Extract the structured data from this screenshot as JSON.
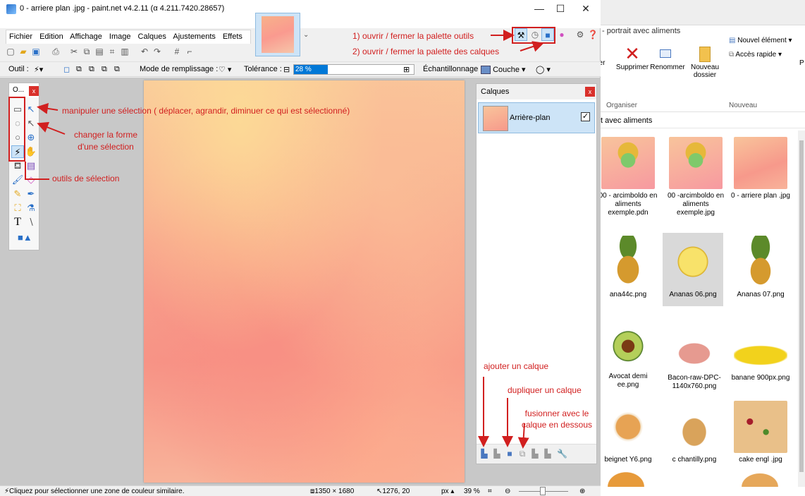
{
  "window": {
    "title": "0 - arriere plan .jpg - paint.net v4.2.11 (α 4.211.7420.28657)",
    "minimize": "—",
    "maximize": "☐",
    "close": "✕"
  },
  "menu": [
    "Fichier",
    "Edition",
    "Affichage",
    "Image",
    "Calques",
    "Ajustements",
    "Effets"
  ],
  "toolbar2": {
    "tool_label": "Outil :",
    "fill_mode_label": "Mode de remplissage :",
    "tolerance_label": "Tolérance :",
    "tolerance_value": "28 %",
    "tolerance_fraction": 0.28,
    "sampling_label": "Échantillonnage :",
    "sampling_value": "Couche"
  },
  "tools_palette": {
    "title": "O...",
    "close": "x"
  },
  "layers_panel": {
    "title": "Calques",
    "close": "x",
    "layer_name": "Arrière-plan",
    "layer_visible_mark": "✓"
  },
  "status": {
    "hint": "Cliquez pour sélectionner une zone de couleur similaire.",
    "image_size": "1350 × 1680",
    "cursor": "1276, 20",
    "unit": "px",
    "zoom": "39 %"
  },
  "explorer": {
    "title": "- portrait avec aliments",
    "address": "t avec aliments",
    "ribbon": {
      "partial": "er",
      "delete": "Supprimer",
      "rename": "Renommer",
      "new_folder": "Nouveau dossier",
      "new_item": "Nouvel élément ▾",
      "quick_access": "Accès rapide ▾",
      "edge": "P",
      "group_organize": "Organiser",
      "group_new": "Nouveau"
    },
    "files": [
      "00 - arcimboldo en aliments exemple.pdn",
      "00 -arcimboldo en aliments exemple.jpg",
      "0 - arriere plan .jpg",
      "ana44c.png",
      "Ananas 06.png",
      "Ananas 07.png",
      "Avocat demi ee.png",
      "Bacon-raw-DPC-1140x760.png",
      "banane 900px.png",
      "beignet Y6.png",
      "c chantilly.png",
      "cake engl .jpg"
    ]
  },
  "annotations": {
    "a1": "1) ouvrir / fermer la palette outils",
    "a2": "2) ouvrir / fermer la palette des calques",
    "a3": "manipuler une sélection ( déplacer, agrandir, diminuer ce qui est sélectionné)",
    "a4": "changer la forme d'une sélection",
    "a5": "outils de sélection",
    "a6": "ajouter un calque",
    "a7": "dupliquer un calque",
    "a8": "fusionner avec le calque en dessous"
  },
  "colors": {
    "annotation": "#d11f1f",
    "selection": "#cde4f7",
    "accent": "#0078d7"
  }
}
